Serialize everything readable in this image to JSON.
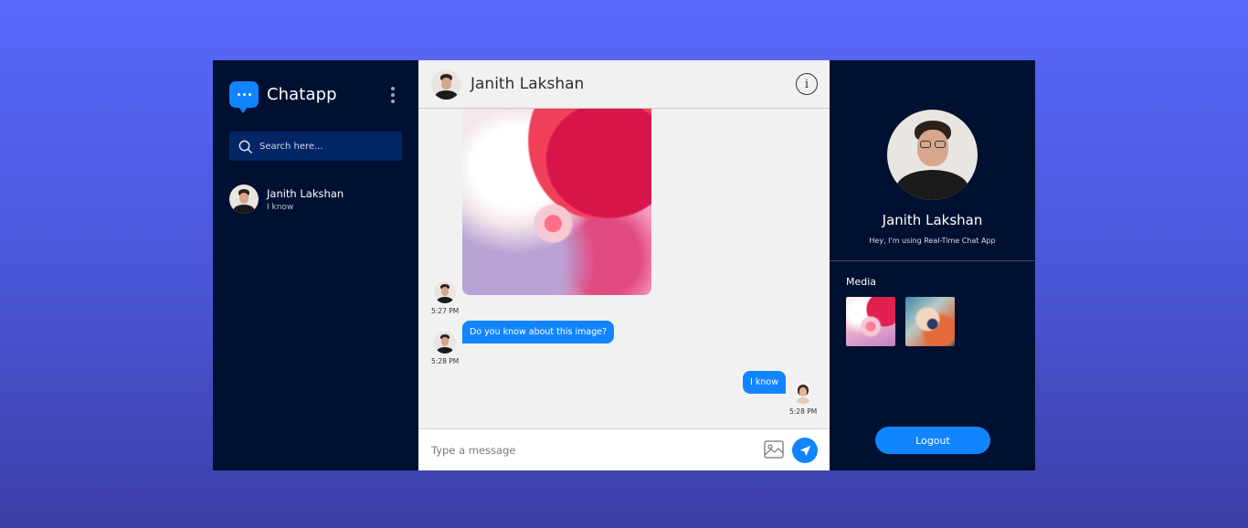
{
  "brand": {
    "name": "Chatapp"
  },
  "search": {
    "placeholder": "Search here..."
  },
  "contacts": [
    {
      "name": "Janith Lakshan",
      "last_message": "I know"
    }
  ],
  "chat": {
    "contact_name": "Janith Lakshan",
    "info_icon": "info-icon",
    "messages": [
      {
        "type": "image",
        "direction": "incoming",
        "time": "5:27 PM"
      },
      {
        "type": "text",
        "direction": "incoming",
        "text": "Do you know about this image?",
        "time": "5:28 PM"
      },
      {
        "type": "text",
        "direction": "outgoing",
        "text": "I know",
        "time": "5:28 PM"
      }
    ],
    "composer": {
      "placeholder": "Type a message",
      "value": ""
    }
  },
  "profile": {
    "name": "Janith Lakshan",
    "status": "Hey, I'm using Real-Time Chat App",
    "media_title": "Media",
    "logout_label": "Logout"
  },
  "colors": {
    "accent": "#1185ff",
    "sidebar_bg": "#001030",
    "search_bg": "#022566",
    "chat_bg": "#f1f1f1"
  }
}
